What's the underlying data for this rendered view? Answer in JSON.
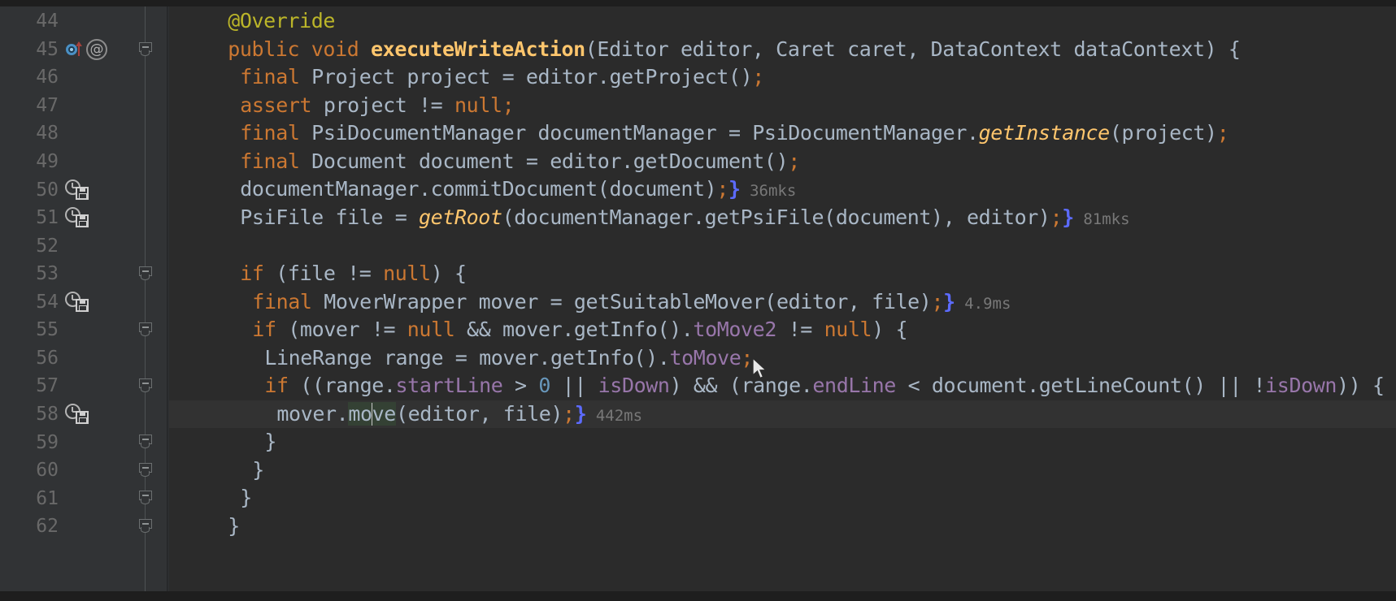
{
  "editor": {
    "language": "java",
    "theme": "darcula",
    "background": "#2B2B2B",
    "gutter_background": "#313335",
    "current_line_background": "#323232",
    "colors": {
      "keyword": "#CC7832",
      "method": "#FFC66D",
      "field": "#9876AA",
      "number": "#6897BB",
      "identifier": "#A9B7C6",
      "annotation": "#BBB529",
      "matched_brace": "#5C6BFF",
      "timing_text": "#787878",
      "line_number": "#696969",
      "identifier_highlight": "#344134"
    },
    "caret_line": 58,
    "lines": [
      {
        "number": "44",
        "indent": 4,
        "fold": null,
        "icons": [],
        "timing": null,
        "tokens": [
          {
            "t": "@Override",
            "c": "anno"
          }
        ]
      },
      {
        "number": "45",
        "indent": 4,
        "fold": "collapse",
        "icons": [
          "overridden-method-icon",
          "annotation-icon"
        ],
        "timing": null,
        "tokens": [
          {
            "t": "public",
            "c": "kw"
          },
          {
            "t": " ",
            "c": "id"
          },
          {
            "t": "void",
            "c": "kw"
          },
          {
            "t": " ",
            "c": "id"
          },
          {
            "t": "executeWriteAction",
            "c": "method"
          },
          {
            "t": "(Editor editor, Caret caret, DataContext dataContext) {",
            "c": "id"
          }
        ]
      },
      {
        "number": "46",
        "indent": 5,
        "fold": null,
        "icons": [],
        "timing": null,
        "tokens": [
          {
            "t": "final",
            "c": "kw"
          },
          {
            "t": " Project project = editor.getProject()",
            "c": "id"
          },
          {
            "t": ";",
            "c": "sep"
          }
        ]
      },
      {
        "number": "47",
        "indent": 5,
        "fold": null,
        "icons": [],
        "timing": null,
        "tokens": [
          {
            "t": "assert",
            "c": "kw"
          },
          {
            "t": " project != ",
            "c": "id"
          },
          {
            "t": "null",
            "c": "kw"
          },
          {
            "t": ";",
            "c": "sep"
          }
        ]
      },
      {
        "number": "48",
        "indent": 5,
        "fold": null,
        "icons": [],
        "timing": null,
        "tokens": [
          {
            "t": "final",
            "c": "kw"
          },
          {
            "t": " PsiDocumentManager documentManager = PsiDocumentManager.",
            "c": "id"
          },
          {
            "t": "getInstance",
            "c": "static-m"
          },
          {
            "t": "(project)",
            "c": "id"
          },
          {
            "t": ";",
            "c": "sep"
          }
        ]
      },
      {
        "number": "49",
        "indent": 5,
        "fold": null,
        "icons": [],
        "timing": null,
        "tokens": [
          {
            "t": "final",
            "c": "kw"
          },
          {
            "t": " Document document = editor.getDocument()",
            "c": "id"
          },
          {
            "t": ";",
            "c": "sep"
          }
        ]
      },
      {
        "number": "50",
        "indent": 5,
        "fold": null,
        "icons": [
          "profiler-timing-icon"
        ],
        "timing": "36mks",
        "tokens": [
          {
            "t": "documentManager.commitDocument(document)",
            "c": "id"
          },
          {
            "t": ";",
            "c": "sep"
          },
          {
            "t": "}",
            "c": "brace-hl"
          }
        ]
      },
      {
        "number": "51",
        "indent": 5,
        "fold": null,
        "icons": [
          "profiler-timing-icon"
        ],
        "timing": "81mks",
        "tokens": [
          {
            "t": "PsiFile file = ",
            "c": "id"
          },
          {
            "t": "getRoot",
            "c": "static-m"
          },
          {
            "t": "(documentManager.getPsiFile(document), editor)",
            "c": "id"
          },
          {
            "t": ";",
            "c": "sep"
          },
          {
            "t": "}",
            "c": "brace-hl"
          }
        ]
      },
      {
        "number": "52",
        "indent": 0,
        "fold": null,
        "icons": [],
        "timing": null,
        "tokens": []
      },
      {
        "number": "53",
        "indent": 5,
        "fold": "collapse",
        "icons": [],
        "timing": null,
        "tokens": [
          {
            "t": "if",
            "c": "kw"
          },
          {
            "t": " (file != ",
            "c": "id"
          },
          {
            "t": "null",
            "c": "kw"
          },
          {
            "t": ") {",
            "c": "id"
          }
        ]
      },
      {
        "number": "54",
        "indent": 6,
        "fold": null,
        "icons": [
          "profiler-timing-icon"
        ],
        "timing": "4.9ms",
        "tokens": [
          {
            "t": "final",
            "c": "kw"
          },
          {
            "t": " MoverWrapper mover = getSuitableMover(editor, file)",
            "c": "id"
          },
          {
            "t": ";",
            "c": "sep"
          },
          {
            "t": "}",
            "c": "brace-hl"
          }
        ]
      },
      {
        "number": "55",
        "indent": 6,
        "fold": "collapse",
        "icons": [],
        "timing": null,
        "tokens": [
          {
            "t": "if",
            "c": "kw"
          },
          {
            "t": " (mover != ",
            "c": "id"
          },
          {
            "t": "null",
            "c": "kw"
          },
          {
            "t": " && mover.getInfo().",
            "c": "id"
          },
          {
            "t": "toMove2",
            "c": "field"
          },
          {
            "t": " != ",
            "c": "id"
          },
          {
            "t": "null",
            "c": "kw"
          },
          {
            "t": ") {",
            "c": "id"
          }
        ]
      },
      {
        "number": "56",
        "indent": 7,
        "fold": null,
        "icons": [],
        "timing": null,
        "tokens": [
          {
            "t": "LineRange range = mover.getInfo().",
            "c": "id"
          },
          {
            "t": "toMove",
            "c": "field"
          },
          {
            "t": ";",
            "c": "sep"
          }
        ]
      },
      {
        "number": "57",
        "indent": 7,
        "fold": "collapse",
        "icons": [],
        "timing": null,
        "tokens": [
          {
            "t": "if",
            "c": "kw"
          },
          {
            "t": " ((range.",
            "c": "id"
          },
          {
            "t": "startLine",
            "c": "field"
          },
          {
            "t": " > ",
            "c": "id"
          },
          {
            "t": "0",
            "c": "num"
          },
          {
            "t": " || ",
            "c": "id"
          },
          {
            "t": "isDown",
            "c": "field"
          },
          {
            "t": ") && (range.",
            "c": "id"
          },
          {
            "t": "endLine",
            "c": "field"
          },
          {
            "t": " < document.getLineCount() || !",
            "c": "id"
          },
          {
            "t": "isDown",
            "c": "field"
          },
          {
            "t": ")) {",
            "c": "id"
          }
        ]
      },
      {
        "number": "58",
        "indent": 8,
        "fold": null,
        "icons": [
          "profiler-timing-icon"
        ],
        "timing": "442ms",
        "current": true,
        "tokens": [
          {
            "t": "mover.",
            "c": "id"
          },
          {
            "t": "mo",
            "c": "ident-hl"
          },
          {
            "t": "CARET",
            "c": "caret"
          },
          {
            "t": "ve",
            "c": "ident-hl"
          },
          {
            "t": "(editor, file)",
            "c": "id"
          },
          {
            "t": ";",
            "c": "sep"
          },
          {
            "t": "}",
            "c": "brace-hl"
          }
        ]
      },
      {
        "number": "59",
        "indent": 7,
        "fold": "expand",
        "icons": [],
        "timing": null,
        "tokens": [
          {
            "t": "}",
            "c": "id"
          }
        ]
      },
      {
        "number": "60",
        "indent": 6,
        "fold": "expand",
        "icons": [],
        "timing": null,
        "tokens": [
          {
            "t": "}",
            "c": "id"
          }
        ]
      },
      {
        "number": "61",
        "indent": 5,
        "fold": "expand",
        "icons": [],
        "timing": null,
        "tokens": [
          {
            "t": "}",
            "c": "id"
          }
        ]
      },
      {
        "number": "62",
        "indent": 4,
        "fold": "expand",
        "icons": [],
        "timing": null,
        "tokens": [
          {
            "t": "}",
            "c": "id"
          }
        ]
      }
    ]
  }
}
